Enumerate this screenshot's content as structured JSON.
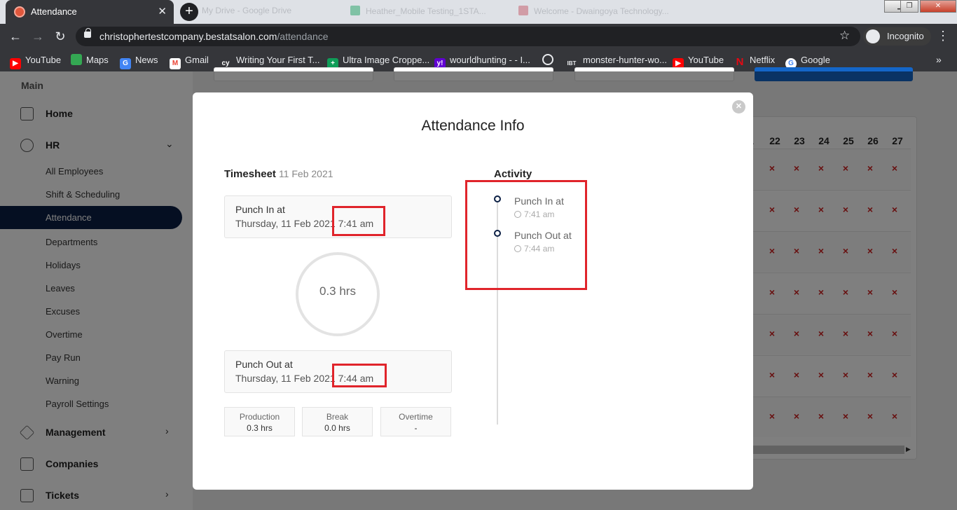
{
  "browser": {
    "active_tab_title": "Attendance",
    "other_tabs": [
      "My Drive - Google Drive",
      "Heather_Mobile Testing_1STA...",
      "Welcome - Dwaingoya Technology..."
    ],
    "url_host": "christophertestcompany.bestatsalon.com",
    "url_path": "/attendance",
    "incognito_label": "Incognito",
    "bookmarks": [
      {
        "label": "YouTube",
        "icon": "youtube-icon",
        "color": "#ff0000"
      },
      {
        "label": "Maps",
        "icon": "maps-icon",
        "color": "#34a853"
      },
      {
        "label": "News",
        "icon": "news-icon",
        "color": "#4285f4"
      },
      {
        "label": "Gmail",
        "icon": "gmail-icon",
        "color": "#ea4335"
      },
      {
        "label": "Writing Your First T...",
        "icon": "cy-icon",
        "color": "#ffffff"
      },
      {
        "label": "Ultra Image Croppe...",
        "icon": "ultra-image-icon",
        "color": "#0f9d58"
      },
      {
        "label": "wourldhunting - - I...",
        "icon": "yahoo-icon",
        "color": "#6001d2"
      },
      {
        "label": "",
        "icon": "globe-icon",
        "color": "#e8eaed"
      },
      {
        "label": "monster-hunter-wo...",
        "icon": "ibt-icon",
        "color": "#e8eaed"
      },
      {
        "label": "YouTube",
        "icon": "youtube-icon",
        "color": "#ff0000"
      },
      {
        "label": "Netflix",
        "icon": "netflix-icon",
        "color": "#e50914"
      },
      {
        "label": "Google",
        "icon": "google-icon",
        "color": "#4285f4"
      }
    ]
  },
  "sidebar": {
    "section_title": "Main",
    "home_label": "Home",
    "hr_label": "HR",
    "hr_items": [
      "All Employees",
      "Shift & Scheduling",
      "Attendance",
      "Departments",
      "Holidays",
      "Leaves",
      "Excuses",
      "Overtime",
      "Pay Run",
      "Warning",
      "Payroll Settings"
    ],
    "management_label": "Management",
    "companies_label": "Companies",
    "tickets_label": "Tickets"
  },
  "background_table": {
    "days": [
      "1",
      "22",
      "23",
      "24",
      "25",
      "26",
      "27"
    ],
    "absent_mark": "×"
  },
  "modal": {
    "title": "Attendance Info",
    "timesheet_label": "Timesheet",
    "timesheet_date": "11 Feb 2021",
    "punch_in_label": "Punch In at",
    "punch_in_datetime": "Thursday, 11 Feb 2021 7:41 am",
    "hours_worked": "0.3 hrs",
    "punch_out_label": "Punch Out at",
    "punch_out_datetime": "Thursday, 11 Feb 2021 7:44 am",
    "stats": [
      {
        "label": "Production",
        "value": "0.3 hrs"
      },
      {
        "label": "Break",
        "value": "0.0 hrs"
      },
      {
        "label": "Overtime",
        "value": "-"
      }
    ],
    "activity_label": "Activity",
    "activity": [
      {
        "label": "Punch In at",
        "time": "7:41 am"
      },
      {
        "label": "Punch Out at",
        "time": "7:44 am"
      }
    ],
    "highlight_color": "#e0242b"
  }
}
